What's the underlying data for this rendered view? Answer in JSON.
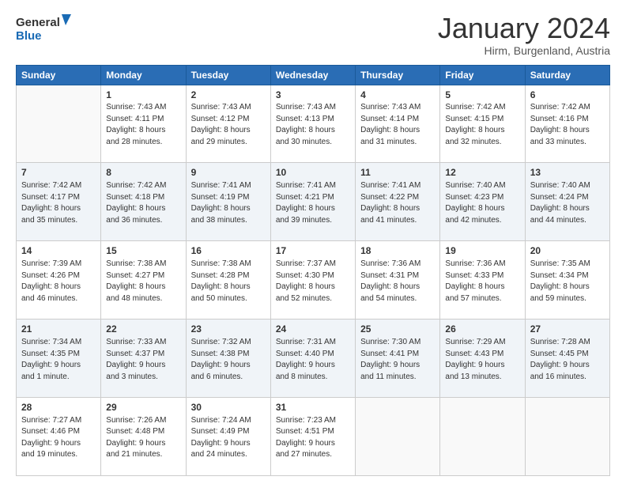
{
  "header": {
    "logo_line1": "General",
    "logo_line2": "Blue",
    "month_year": "January 2024",
    "location": "Hirm, Burgenland, Austria"
  },
  "weekdays": [
    "Sunday",
    "Monday",
    "Tuesday",
    "Wednesday",
    "Thursday",
    "Friday",
    "Saturday"
  ],
  "weeks": [
    [
      {
        "day": "",
        "info": ""
      },
      {
        "day": "1",
        "info": "Sunrise: 7:43 AM\nSunset: 4:11 PM\nDaylight: 8 hours\nand 28 minutes."
      },
      {
        "day": "2",
        "info": "Sunrise: 7:43 AM\nSunset: 4:12 PM\nDaylight: 8 hours\nand 29 minutes."
      },
      {
        "day": "3",
        "info": "Sunrise: 7:43 AM\nSunset: 4:13 PM\nDaylight: 8 hours\nand 30 minutes."
      },
      {
        "day": "4",
        "info": "Sunrise: 7:43 AM\nSunset: 4:14 PM\nDaylight: 8 hours\nand 31 minutes."
      },
      {
        "day": "5",
        "info": "Sunrise: 7:42 AM\nSunset: 4:15 PM\nDaylight: 8 hours\nand 32 minutes."
      },
      {
        "day": "6",
        "info": "Sunrise: 7:42 AM\nSunset: 4:16 PM\nDaylight: 8 hours\nand 33 minutes."
      }
    ],
    [
      {
        "day": "7",
        "info": "Sunrise: 7:42 AM\nSunset: 4:17 PM\nDaylight: 8 hours\nand 35 minutes."
      },
      {
        "day": "8",
        "info": "Sunrise: 7:42 AM\nSunset: 4:18 PM\nDaylight: 8 hours\nand 36 minutes."
      },
      {
        "day": "9",
        "info": "Sunrise: 7:41 AM\nSunset: 4:19 PM\nDaylight: 8 hours\nand 38 minutes."
      },
      {
        "day": "10",
        "info": "Sunrise: 7:41 AM\nSunset: 4:21 PM\nDaylight: 8 hours\nand 39 minutes."
      },
      {
        "day": "11",
        "info": "Sunrise: 7:41 AM\nSunset: 4:22 PM\nDaylight: 8 hours\nand 41 minutes."
      },
      {
        "day": "12",
        "info": "Sunrise: 7:40 AM\nSunset: 4:23 PM\nDaylight: 8 hours\nand 42 minutes."
      },
      {
        "day": "13",
        "info": "Sunrise: 7:40 AM\nSunset: 4:24 PM\nDaylight: 8 hours\nand 44 minutes."
      }
    ],
    [
      {
        "day": "14",
        "info": "Sunrise: 7:39 AM\nSunset: 4:26 PM\nDaylight: 8 hours\nand 46 minutes."
      },
      {
        "day": "15",
        "info": "Sunrise: 7:38 AM\nSunset: 4:27 PM\nDaylight: 8 hours\nand 48 minutes."
      },
      {
        "day": "16",
        "info": "Sunrise: 7:38 AM\nSunset: 4:28 PM\nDaylight: 8 hours\nand 50 minutes."
      },
      {
        "day": "17",
        "info": "Sunrise: 7:37 AM\nSunset: 4:30 PM\nDaylight: 8 hours\nand 52 minutes."
      },
      {
        "day": "18",
        "info": "Sunrise: 7:36 AM\nSunset: 4:31 PM\nDaylight: 8 hours\nand 54 minutes."
      },
      {
        "day": "19",
        "info": "Sunrise: 7:36 AM\nSunset: 4:33 PM\nDaylight: 8 hours\nand 57 minutes."
      },
      {
        "day": "20",
        "info": "Sunrise: 7:35 AM\nSunset: 4:34 PM\nDaylight: 8 hours\nand 59 minutes."
      }
    ],
    [
      {
        "day": "21",
        "info": "Sunrise: 7:34 AM\nSunset: 4:35 PM\nDaylight: 9 hours\nand 1 minute."
      },
      {
        "day": "22",
        "info": "Sunrise: 7:33 AM\nSunset: 4:37 PM\nDaylight: 9 hours\nand 3 minutes."
      },
      {
        "day": "23",
        "info": "Sunrise: 7:32 AM\nSunset: 4:38 PM\nDaylight: 9 hours\nand 6 minutes."
      },
      {
        "day": "24",
        "info": "Sunrise: 7:31 AM\nSunset: 4:40 PM\nDaylight: 9 hours\nand 8 minutes."
      },
      {
        "day": "25",
        "info": "Sunrise: 7:30 AM\nSunset: 4:41 PM\nDaylight: 9 hours\nand 11 minutes."
      },
      {
        "day": "26",
        "info": "Sunrise: 7:29 AM\nSunset: 4:43 PM\nDaylight: 9 hours\nand 13 minutes."
      },
      {
        "day": "27",
        "info": "Sunrise: 7:28 AM\nSunset: 4:45 PM\nDaylight: 9 hours\nand 16 minutes."
      }
    ],
    [
      {
        "day": "28",
        "info": "Sunrise: 7:27 AM\nSunset: 4:46 PM\nDaylight: 9 hours\nand 19 minutes."
      },
      {
        "day": "29",
        "info": "Sunrise: 7:26 AM\nSunset: 4:48 PM\nDaylight: 9 hours\nand 21 minutes."
      },
      {
        "day": "30",
        "info": "Sunrise: 7:24 AM\nSunset: 4:49 PM\nDaylight: 9 hours\nand 24 minutes."
      },
      {
        "day": "31",
        "info": "Sunrise: 7:23 AM\nSunset: 4:51 PM\nDaylight: 9 hours\nand 27 minutes."
      },
      {
        "day": "",
        "info": ""
      },
      {
        "day": "",
        "info": ""
      },
      {
        "day": "",
        "info": ""
      }
    ]
  ]
}
